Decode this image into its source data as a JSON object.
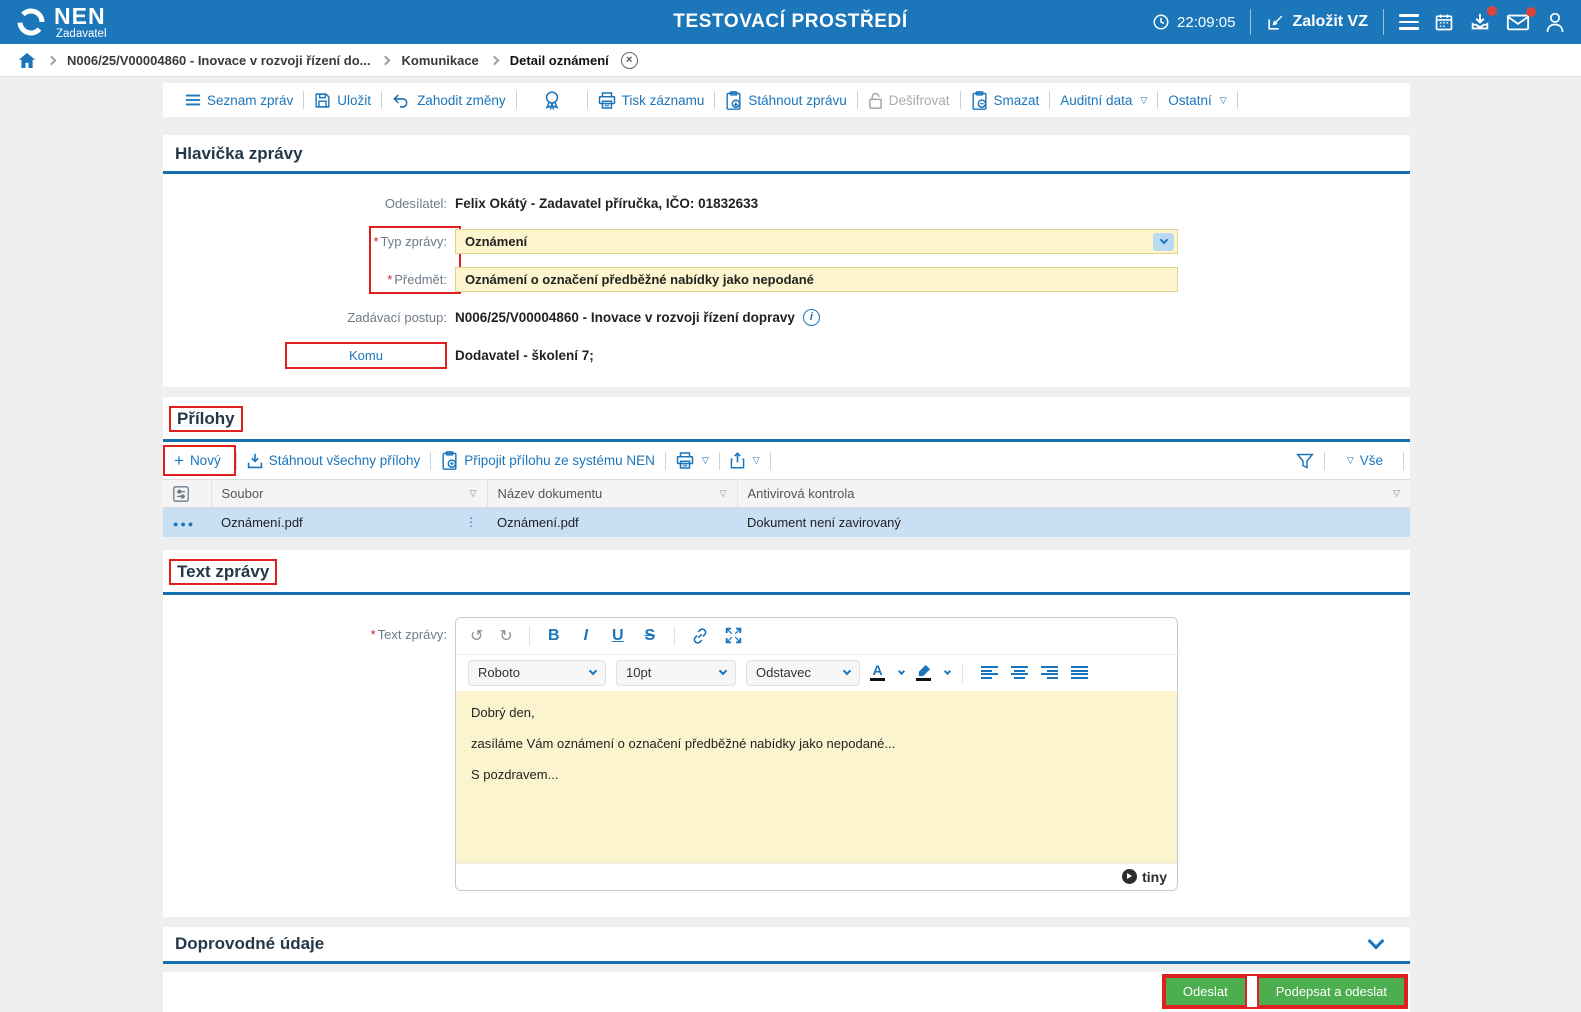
{
  "misc": {
    "required": "*",
    "tri": "▽",
    "vdots": "⋮",
    "row_menu": "●●●",
    "close": "×",
    "info": "i",
    "undo": "↺",
    "redo": "↻",
    "bold": "B",
    "italic": "I",
    "underline": "U",
    "strike": "S",
    "plus": "+"
  },
  "topbar": {
    "logo": "NEN",
    "logo_sub": "Zadavatel",
    "title": "TESTOVACÍ PROSTŘEDÍ",
    "time": "22:09:05",
    "create_vz": "Založit VZ"
  },
  "breadcrumb": {
    "items": [
      "N006/25/V00004860 - Inovace v rozvoji řízení do...",
      "Komunikace",
      "Detail oznámení"
    ]
  },
  "actions": {
    "list": "Seznam zpráv",
    "save": "Uložit",
    "discard": "Zahodit změny",
    "print": "Tisk záznamu",
    "download": "Stáhnout zprávu",
    "decrypt": "Dešifrovat",
    "delete": "Smazat",
    "audit": "Auditní data",
    "other": "Ostatní"
  },
  "message": {
    "section_title": "Hlavička zprávy",
    "sender_label": "Odesílatel:",
    "sender_value": "Felix Okátý - Zadavatel příručka, IČO: 01832633",
    "type_label": "Typ zprávy:",
    "type_value": "Oznámení",
    "subject_label": "Předmět:",
    "subject_value": "Oznámení o označení předběžné nabídky jako nepodané",
    "procedure_label": "Zadávací postup:",
    "procedure_value": "N006/25/V00004860 - Inovace v rozvoji řízení dopravy",
    "to_label": "Komu",
    "to_value": "Dodavatel - školení 7;"
  },
  "attachments": {
    "section_title": "Přílohy",
    "new_label": "Nový",
    "download_all": "Stáhnout všechny přílohy",
    "attach_nen": "Připojit přílohu ze systému NEN",
    "filter_all": "Vše",
    "columns": [
      "Soubor",
      "Název dokumentu",
      "Antivirová kontrola"
    ],
    "rows": [
      {
        "file": "Oznámení.pdf",
        "doc": "Oznámení.pdf",
        "antivirus": "Dokument není zavirovaný"
      }
    ]
  },
  "text_section": {
    "section_title": "Text zprávy",
    "label": "Text zprávy:",
    "font_name": "Roboto",
    "font_size": "10pt",
    "block_format": "Odstavec",
    "paragraphs": [
      "Dobrý den,",
      "zasíláme Vám oznámení o označení předběžné nabídky jako nepodané...",
      "S pozdravem..."
    ],
    "brand": "tiny"
  },
  "additional": {
    "section_title": "Doprovodné údaje"
  },
  "footer": {
    "send": "Odeslat",
    "sign_send": "Podepsat a odeslat"
  },
  "colors": {
    "header_blue": "#1C76BA",
    "accent": "#1B75BB",
    "section_line": "#1470AE",
    "field_yellow": "#FCF5CD",
    "selected_row": "#C8DFF4",
    "green": "#4CAE4E",
    "annotation": "#E02020"
  }
}
